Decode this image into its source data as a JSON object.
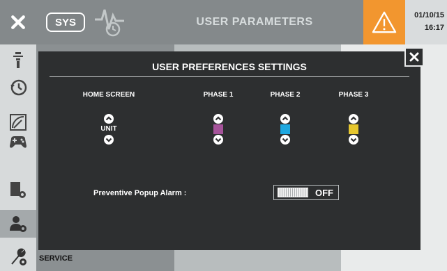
{
  "header": {
    "system_badge": "SYS",
    "title": "USER PARAMETERS",
    "date": "01/10/15",
    "time": "16:17",
    "warning_color": "#f2962f"
  },
  "sidebar": {
    "items": [
      {
        "icon": "probe-icon"
      },
      {
        "icon": "history-icon"
      },
      {
        "icon": "gauge-icon"
      },
      {
        "icon": "gamepad-icon"
      },
      {
        "icon": "doc-settings-icon"
      },
      {
        "icon": "user-settings-icon",
        "active": true
      },
      {
        "icon": "wrench-gear-icon",
        "label": "SERVICE"
      }
    ]
  },
  "modal": {
    "title": "USER PREFERENCES SETTINGS",
    "columns": {
      "home_screen": "HOME SCREEN",
      "phase1": "PHASE 1",
      "phase2": "PHASE 2",
      "phase3": "PHASE 3"
    },
    "home_screen_value": "UNIT",
    "phase_colors": {
      "phase1": "#a5539a",
      "phase2": "#1ea8e0",
      "phase3": "#e6c72f"
    },
    "preventive_popup_label": "Preventive Popup Alarm :",
    "toggle_state": "OFF"
  }
}
